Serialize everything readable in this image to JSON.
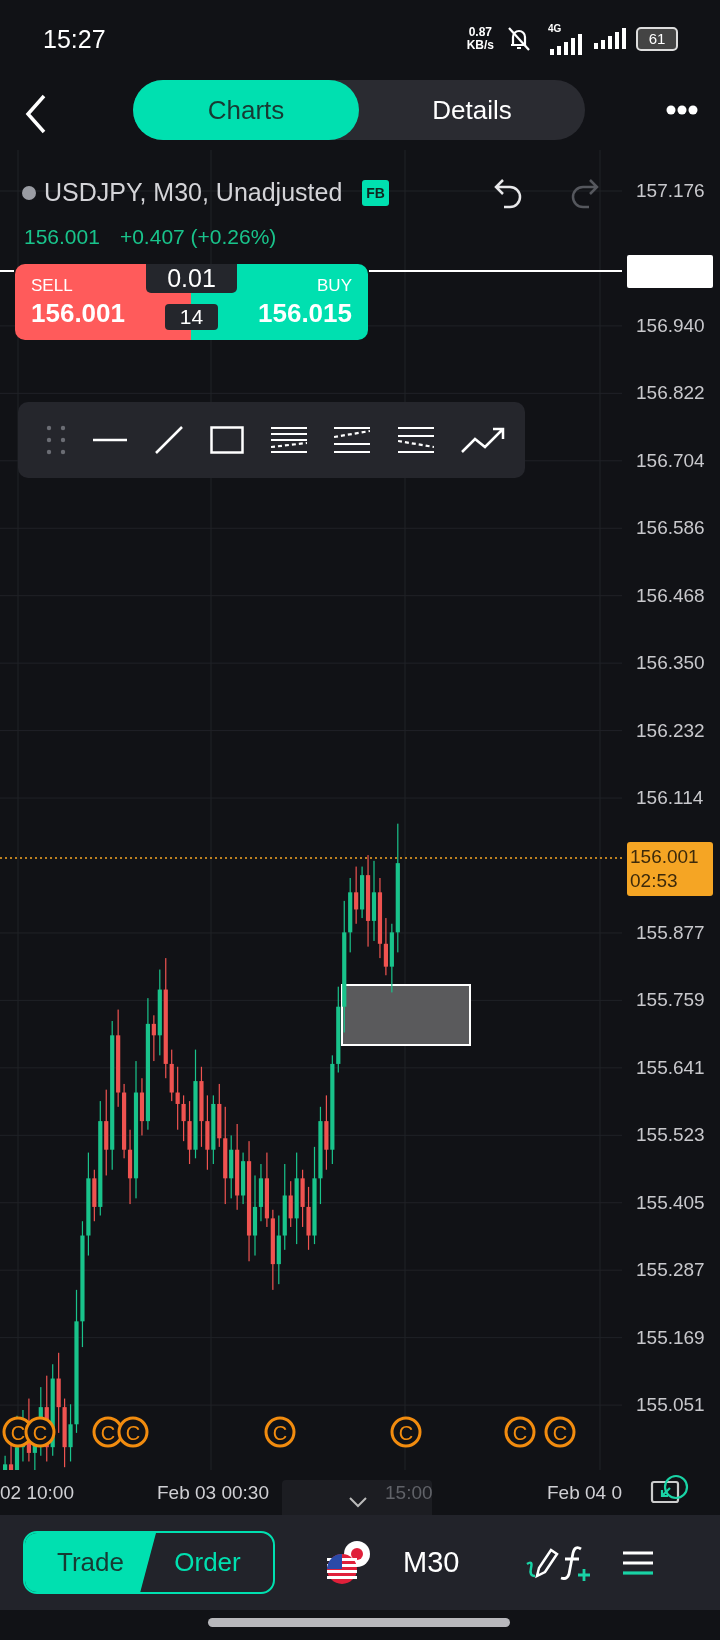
{
  "status_bar": {
    "time": "15:27",
    "net_speed": "0.87",
    "net_unit": "KB/s",
    "network": "4G",
    "battery": "61"
  },
  "nav": {
    "tabs": [
      {
        "label": "Charts",
        "selected": true
      },
      {
        "label": "Details",
        "selected": false
      }
    ]
  },
  "chart": {
    "symbol": "USDJPY, M30, Unadjusted",
    "badge": "FB",
    "price": "156.001",
    "change": "+0.407 (+0.26%)",
    "history_buttons": [
      {
        "kind": "undo",
        "disabled": false
      },
      {
        "kind": "redo",
        "disabled": true
      }
    ],
    "trade": {
      "sell_label": "SELL",
      "sell_price": "156.001",
      "lot": "0.01",
      "spread": "14",
      "buy_label": "BUY",
      "buy_price": "156.015"
    },
    "price_axis": [
      "157.176",
      "156.940",
      "156.822",
      "156.704",
      "156.586",
      "156.468",
      "156.350",
      "156.232",
      "156.114",
      "155.877",
      "155.759",
      "155.641",
      "155.523",
      "155.405",
      "155.287",
      "155.169",
      "155.051"
    ],
    "current_price": "156.001",
    "countdown": "02:53",
    "markers": [
      "C",
      "C",
      "C",
      "C",
      "C",
      "C",
      "C",
      "C"
    ],
    "time_axis": [
      "02 10:00",
      "Feb 03 00:30",
      "15:00",
      "Feb 04 0"
    ]
  },
  "bottom_bar": {
    "modes": [
      {
        "label": "Trade",
        "selected": true
      },
      {
        "label": "Order",
        "selected": false
      }
    ],
    "timeframe": "M30"
  }
}
